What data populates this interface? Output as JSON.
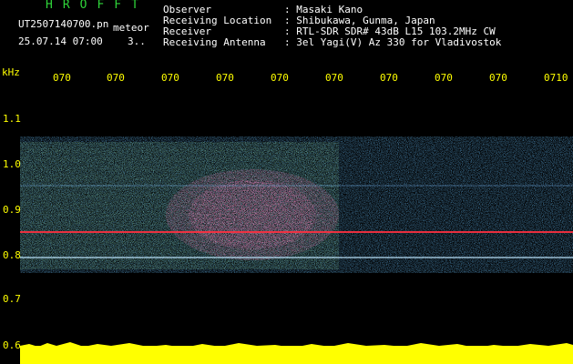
{
  "header": {
    "brand": "HROFFT",
    "filename": "UT2507140700.pn",
    "tag": "meteor",
    "datetime": "25.07.14 07:00",
    "indicator": "3..",
    "fields": [
      {
        "label": "Observer",
        "value": ": Masaki Kano"
      },
      {
        "label": "Receiving Location",
        "value": ": Shibukawa, Gunma, Japan"
      },
      {
        "label": "Receiver",
        "value": ": RTL-SDR SDR# 43dB L15 103.2MHz CW"
      },
      {
        "label": "Receiving Antenna",
        "value": ": 3el Yagi(V) Az 330 for Vladivostok"
      }
    ]
  },
  "y_axis": {
    "unit": "kHz",
    "ticks": [
      "1.1",
      "1.0",
      "0.9",
      "0.8",
      "0.7",
      "0.6"
    ]
  },
  "x_axis": {
    "ticks": [
      "070",
      "070",
      "070",
      "070",
      "070",
      "070",
      "070",
      "070",
      "070",
      "0710"
    ]
  },
  "colors": {
    "background": "#000000",
    "axis_text": "#ffff00",
    "brand": "#2fd53a",
    "meta_text": "#ffffff",
    "carrier_line": "#ff3040",
    "amplitude": "#ffff00"
  }
}
